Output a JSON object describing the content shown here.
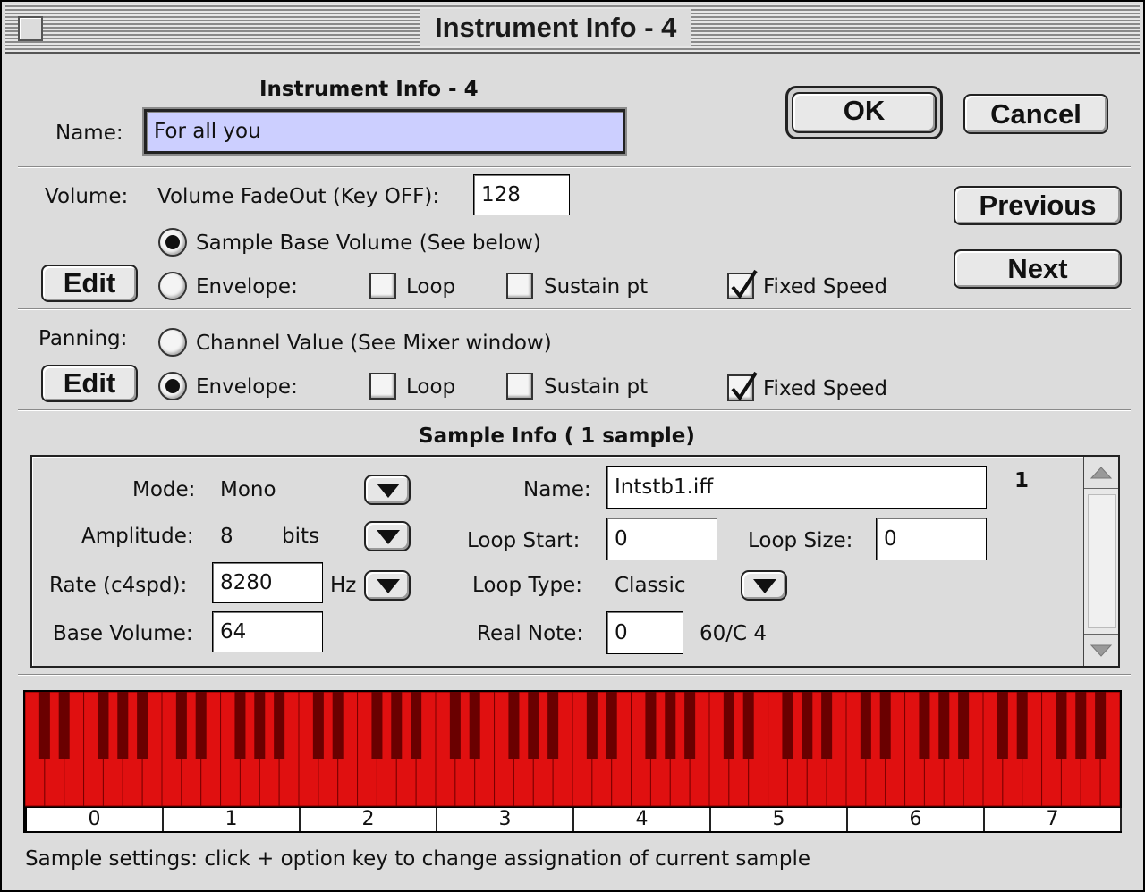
{
  "window": {
    "title": "Instrument Info - 4"
  },
  "header": {
    "heading": "Instrument Info - 4",
    "name_label": "Name:",
    "name_value": "For all you"
  },
  "buttons": {
    "ok": "OK",
    "cancel": "Cancel",
    "previous": "Previous",
    "next": "Next",
    "edit": "Edit"
  },
  "volume": {
    "label": "Volume:",
    "fadeout_label": "Volume FadeOut (Key OFF):",
    "fadeout_value": "128",
    "sample_base_label": "Sample Base Volume (See below)",
    "sample_base_selected": true,
    "envelope_label": "Envelope:",
    "envelope_selected": false,
    "loop_label": "Loop",
    "loop_checked": false,
    "sustain_label": "Sustain pt",
    "sustain_checked": false,
    "fixed_speed_label": "Fixed Speed",
    "fixed_speed_checked": true
  },
  "panning": {
    "label": "Panning:",
    "channel_label": "Channel Value (See Mixer window)",
    "channel_selected": false,
    "envelope_label": "Envelope:",
    "envelope_selected": true,
    "loop_label": "Loop",
    "loop_checked": false,
    "sustain_label": "Sustain pt",
    "sustain_checked": false,
    "fixed_speed_label": "Fixed Speed",
    "fixed_speed_checked": true
  },
  "sample_info": {
    "heading": "Sample Info ( 1 sample)",
    "index": "1",
    "mode_label": "Mode:",
    "mode_value": "Mono",
    "amplitude_label": "Amplitude:",
    "amplitude_value": "8",
    "amplitude_unit": "bits",
    "rate_label": "Rate (c4spd):",
    "rate_value": "8280",
    "rate_unit": "Hz",
    "base_volume_label": "Base Volume:",
    "base_volume_value": "64",
    "name_label": "Name:",
    "name_value": "Intstb1.iff",
    "loop_start_label": "Loop Start:",
    "loop_start_value": "0",
    "loop_size_label": "Loop Size:",
    "loop_size_value": "0",
    "loop_type_label": "Loop Type:",
    "loop_type_value": "Classic",
    "real_note_label": "Real Note:",
    "real_note_value": "0",
    "real_note_display": "60/C 4"
  },
  "keyboard": {
    "octaves": [
      "0",
      "1",
      "2",
      "3",
      "4",
      "5",
      "6",
      "7"
    ],
    "key_color": "#e01010",
    "black_key_color": "#6a0000"
  },
  "status": {
    "text": "Sample settings: click + option key to change assignation of current sample"
  }
}
